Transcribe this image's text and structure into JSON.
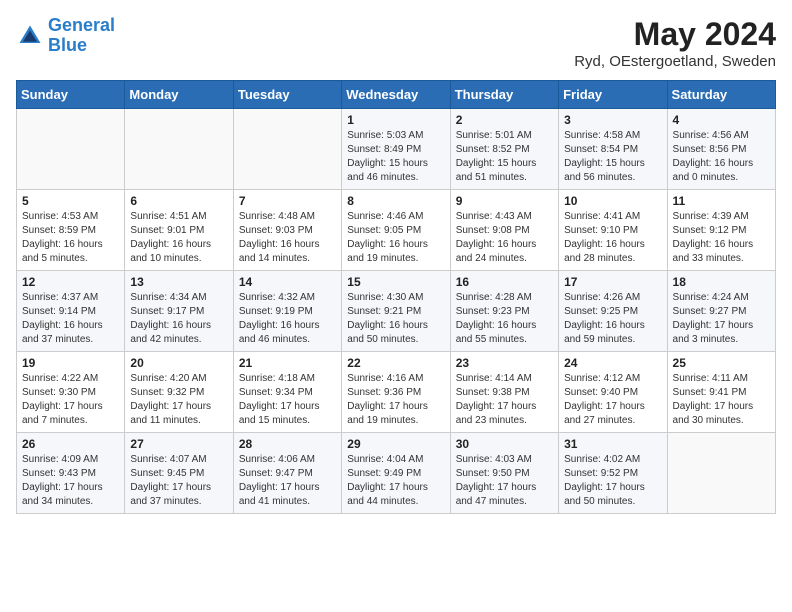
{
  "header": {
    "logo_line1": "General",
    "logo_line2": "Blue",
    "month_title": "May 2024",
    "subtitle": "Ryd, OEstergoetland, Sweden"
  },
  "weekdays": [
    "Sunday",
    "Monday",
    "Tuesday",
    "Wednesday",
    "Thursday",
    "Friday",
    "Saturday"
  ],
  "weeks": [
    [
      {
        "day": "",
        "info": ""
      },
      {
        "day": "",
        "info": ""
      },
      {
        "day": "",
        "info": ""
      },
      {
        "day": "1",
        "info": "Sunrise: 5:03 AM\nSunset: 8:49 PM\nDaylight: 15 hours\nand 46 minutes."
      },
      {
        "day": "2",
        "info": "Sunrise: 5:01 AM\nSunset: 8:52 PM\nDaylight: 15 hours\nand 51 minutes."
      },
      {
        "day": "3",
        "info": "Sunrise: 4:58 AM\nSunset: 8:54 PM\nDaylight: 15 hours\nand 56 minutes."
      },
      {
        "day": "4",
        "info": "Sunrise: 4:56 AM\nSunset: 8:56 PM\nDaylight: 16 hours\nand 0 minutes."
      }
    ],
    [
      {
        "day": "5",
        "info": "Sunrise: 4:53 AM\nSunset: 8:59 PM\nDaylight: 16 hours\nand 5 minutes."
      },
      {
        "day": "6",
        "info": "Sunrise: 4:51 AM\nSunset: 9:01 PM\nDaylight: 16 hours\nand 10 minutes."
      },
      {
        "day": "7",
        "info": "Sunrise: 4:48 AM\nSunset: 9:03 PM\nDaylight: 16 hours\nand 14 minutes."
      },
      {
        "day": "8",
        "info": "Sunrise: 4:46 AM\nSunset: 9:05 PM\nDaylight: 16 hours\nand 19 minutes."
      },
      {
        "day": "9",
        "info": "Sunrise: 4:43 AM\nSunset: 9:08 PM\nDaylight: 16 hours\nand 24 minutes."
      },
      {
        "day": "10",
        "info": "Sunrise: 4:41 AM\nSunset: 9:10 PM\nDaylight: 16 hours\nand 28 minutes."
      },
      {
        "day": "11",
        "info": "Sunrise: 4:39 AM\nSunset: 9:12 PM\nDaylight: 16 hours\nand 33 minutes."
      }
    ],
    [
      {
        "day": "12",
        "info": "Sunrise: 4:37 AM\nSunset: 9:14 PM\nDaylight: 16 hours\nand 37 minutes."
      },
      {
        "day": "13",
        "info": "Sunrise: 4:34 AM\nSunset: 9:17 PM\nDaylight: 16 hours\nand 42 minutes."
      },
      {
        "day": "14",
        "info": "Sunrise: 4:32 AM\nSunset: 9:19 PM\nDaylight: 16 hours\nand 46 minutes."
      },
      {
        "day": "15",
        "info": "Sunrise: 4:30 AM\nSunset: 9:21 PM\nDaylight: 16 hours\nand 50 minutes."
      },
      {
        "day": "16",
        "info": "Sunrise: 4:28 AM\nSunset: 9:23 PM\nDaylight: 16 hours\nand 55 minutes."
      },
      {
        "day": "17",
        "info": "Sunrise: 4:26 AM\nSunset: 9:25 PM\nDaylight: 16 hours\nand 59 minutes."
      },
      {
        "day": "18",
        "info": "Sunrise: 4:24 AM\nSunset: 9:27 PM\nDaylight: 17 hours\nand 3 minutes."
      }
    ],
    [
      {
        "day": "19",
        "info": "Sunrise: 4:22 AM\nSunset: 9:30 PM\nDaylight: 17 hours\nand 7 minutes."
      },
      {
        "day": "20",
        "info": "Sunrise: 4:20 AM\nSunset: 9:32 PM\nDaylight: 17 hours\nand 11 minutes."
      },
      {
        "day": "21",
        "info": "Sunrise: 4:18 AM\nSunset: 9:34 PM\nDaylight: 17 hours\nand 15 minutes."
      },
      {
        "day": "22",
        "info": "Sunrise: 4:16 AM\nSunset: 9:36 PM\nDaylight: 17 hours\nand 19 minutes."
      },
      {
        "day": "23",
        "info": "Sunrise: 4:14 AM\nSunset: 9:38 PM\nDaylight: 17 hours\nand 23 minutes."
      },
      {
        "day": "24",
        "info": "Sunrise: 4:12 AM\nSunset: 9:40 PM\nDaylight: 17 hours\nand 27 minutes."
      },
      {
        "day": "25",
        "info": "Sunrise: 4:11 AM\nSunset: 9:41 PM\nDaylight: 17 hours\nand 30 minutes."
      }
    ],
    [
      {
        "day": "26",
        "info": "Sunrise: 4:09 AM\nSunset: 9:43 PM\nDaylight: 17 hours\nand 34 minutes."
      },
      {
        "day": "27",
        "info": "Sunrise: 4:07 AM\nSunset: 9:45 PM\nDaylight: 17 hours\nand 37 minutes."
      },
      {
        "day": "28",
        "info": "Sunrise: 4:06 AM\nSunset: 9:47 PM\nDaylight: 17 hours\nand 41 minutes."
      },
      {
        "day": "29",
        "info": "Sunrise: 4:04 AM\nSunset: 9:49 PM\nDaylight: 17 hours\nand 44 minutes."
      },
      {
        "day": "30",
        "info": "Sunrise: 4:03 AM\nSunset: 9:50 PM\nDaylight: 17 hours\nand 47 minutes."
      },
      {
        "day": "31",
        "info": "Sunrise: 4:02 AM\nSunset: 9:52 PM\nDaylight: 17 hours\nand 50 minutes."
      },
      {
        "day": "",
        "info": ""
      }
    ]
  ]
}
